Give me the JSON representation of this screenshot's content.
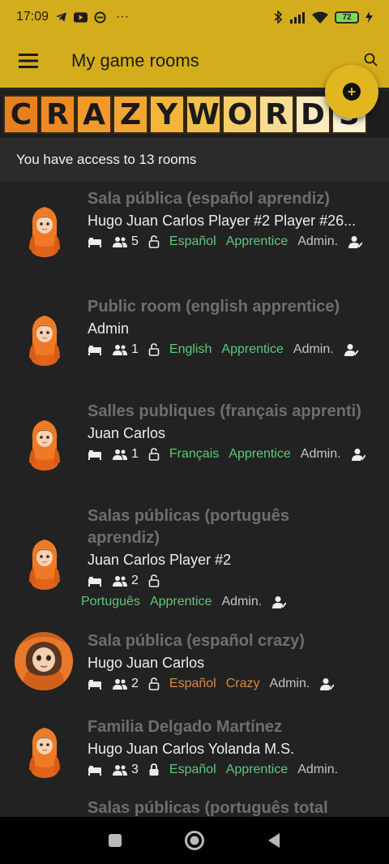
{
  "status_bar": {
    "time": "17:09",
    "more": "···",
    "battery": "72",
    "icons": [
      "telegram-icon",
      "youtube-icon",
      "vpn-icon",
      "bluetooth-icon",
      "signal-icon",
      "wifi-icon",
      "charging-icon"
    ]
  },
  "appbar": {
    "title": "My game rooms",
    "menu_icon": "hamburger-icon",
    "search_icon": "search-icon",
    "bg_color": "#d4ad1c"
  },
  "banner": {
    "letters": [
      "C",
      "R",
      "A",
      "Z",
      "Y",
      "W",
      "O",
      "R",
      "D",
      "S"
    ]
  },
  "fab": {
    "label": "+"
  },
  "access_text": "You have access to 13 rooms",
  "rooms": [
    {
      "title": "Sala pública (español aprendiz)",
      "members": "Hugo Juan Carlos Player #2 Player #26...",
      "count": "5",
      "lock": "open",
      "language": "Español",
      "level": "Apprentice",
      "admin": "Admin."
    },
    {
      "title": "Public room (english apprentice)",
      "members": "Admin",
      "count": "1",
      "lock": "open",
      "language": "English",
      "level": "Apprentice",
      "admin": "Admin."
    },
    {
      "title": "Salles publiques (français apprenti)",
      "members": "Juan Carlos",
      "count": "1",
      "lock": "open",
      "language": "Français",
      "level": "Apprentice",
      "admin": "Admin."
    },
    {
      "title": "Salas públicas (português aprendiz)",
      "members": "Juan Carlos Player #2",
      "count": "2",
      "lock": "open",
      "language": "Português",
      "level": "Apprentice",
      "admin": "Admin."
    },
    {
      "title": "Sala pública (español crazy)",
      "members": "Hugo Juan Carlos",
      "count": "2",
      "lock": "open",
      "language": "Español",
      "level": "Crazy",
      "admin": "Admin."
    },
    {
      "title": "Familia Delgado Martínez",
      "members": "Hugo Juan Carlos Yolanda M.S.",
      "count": "3",
      "lock": "closed",
      "language": "Español",
      "level": "Apprentice",
      "admin": "Admin."
    },
    {
      "title": "Salas públicas (português total"
    }
  ],
  "colors": {
    "accent": "#d4ad1c",
    "language_green": "#5fc878",
    "crazy_orange": "#d8893f",
    "background": "#222222"
  },
  "nav_bar": {
    "icons": [
      "recents-square-icon",
      "home-circle-icon",
      "back-triangle-icon"
    ]
  }
}
